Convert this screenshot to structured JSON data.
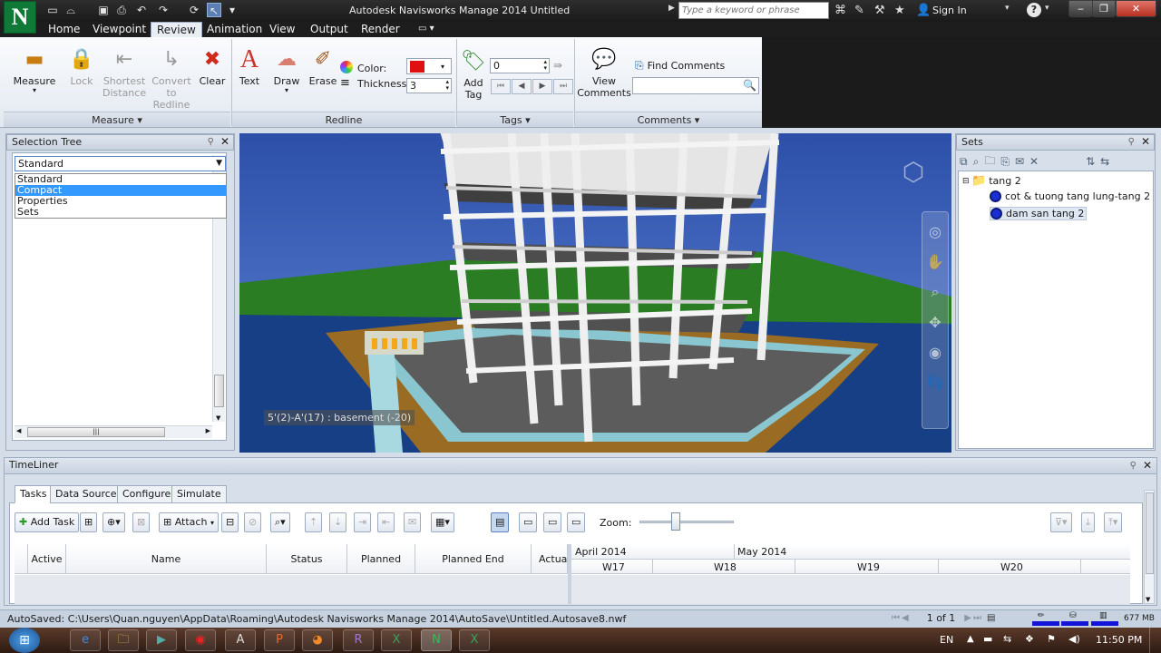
{
  "titlebar": {
    "app_title": "Autodesk Navisworks Manage 2014    Untitled",
    "search_placeholder": "Type a keyword or phrase",
    "sign_in": "Sign In",
    "help": "?"
  },
  "ribbon_tabs": [
    "Home",
    "Viewpoint",
    "Review",
    "Animation",
    "View",
    "Output",
    "Render"
  ],
  "ribbon": {
    "measure": {
      "measure": "Measure",
      "lock": "Lock",
      "shortest_1": "Shortest",
      "shortest_2": "Distance",
      "convert_1": "Convert",
      "convert_2": "to Redline",
      "clear": "Clear",
      "panel": "Measure ▾"
    },
    "redline": {
      "text": "Text",
      "draw": "Draw",
      "erase": "Erase",
      "color": "Color:",
      "thickness": "Thickness:",
      "thickness_value": "3",
      "panel": "Redline",
      "color_hex": "#e01010"
    },
    "tags": {
      "add_1": "Add",
      "add_2": "Tag",
      "tag_value": "0",
      "panel": "Tags ▾"
    },
    "comments": {
      "view_1": "View",
      "view_2": "Comments",
      "find": "Find Comments",
      "panel": "Comments ▾"
    }
  },
  "selection_tree": {
    "title": "Selection Tree",
    "selected": "Standard",
    "options": [
      "Standard",
      "Compact",
      "Properties",
      "Sets"
    ],
    "highlighted": "Compact"
  },
  "viewport": {
    "tooltip": "5'(2)-A'(17) : basement (-20)"
  },
  "sets": {
    "title": "Sets",
    "folder": "tang 2",
    "items": [
      "cot & tuong tang lung-tang 2",
      "dam san tang 2"
    ]
  },
  "timeliner": {
    "title": "TimeLiner",
    "tabs": [
      "Tasks",
      "Data Sources",
      "Configure",
      "Simulate"
    ],
    "add_task": "Add Task",
    "attach": "Attach",
    "zoom": "Zoom:",
    "zoom_level": 0.37,
    "columns": [
      "Active",
      "Name",
      "Status",
      "Planned Start",
      "Planned End",
      "Actual"
    ],
    "months": [
      "April 2014",
      "May 2014"
    ],
    "weeks": [
      "W17",
      "W18",
      "W19",
      "W20"
    ]
  },
  "statusbar": {
    "autosave": "AutoSaved: C:\\Users\\Quan.nguyen\\AppData\\Roaming\\Autodesk Navisworks Manage 2014\\AutoSave\\Untitled.Autosave8.nwf",
    "page": "1 of 1",
    "memory": "677 MB"
  },
  "taskbar": {
    "lang": "EN",
    "time": "11:50 PM"
  }
}
